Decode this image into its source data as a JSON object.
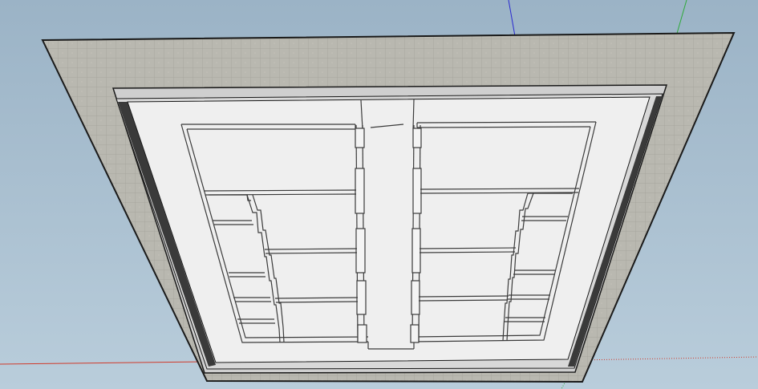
{
  "viewport": {
    "sky_top": "#9bb3c6",
    "sky_bottom": "#b9cddb"
  },
  "axes": {
    "x_axis_color": "#d03a2a",
    "y_axis_color": "#2eaa3a",
    "z_axis_color": "#2a2ad0"
  },
  "model": {
    "concrete_color": "#b9b8b0",
    "concrete_grid_color": "#a7a69e",
    "edge_color": "#1a1a1a",
    "recess_shadow_color": "#3a3a3a",
    "inner_panel_color": "#efefef",
    "partition_color": "#3b3b3b"
  }
}
